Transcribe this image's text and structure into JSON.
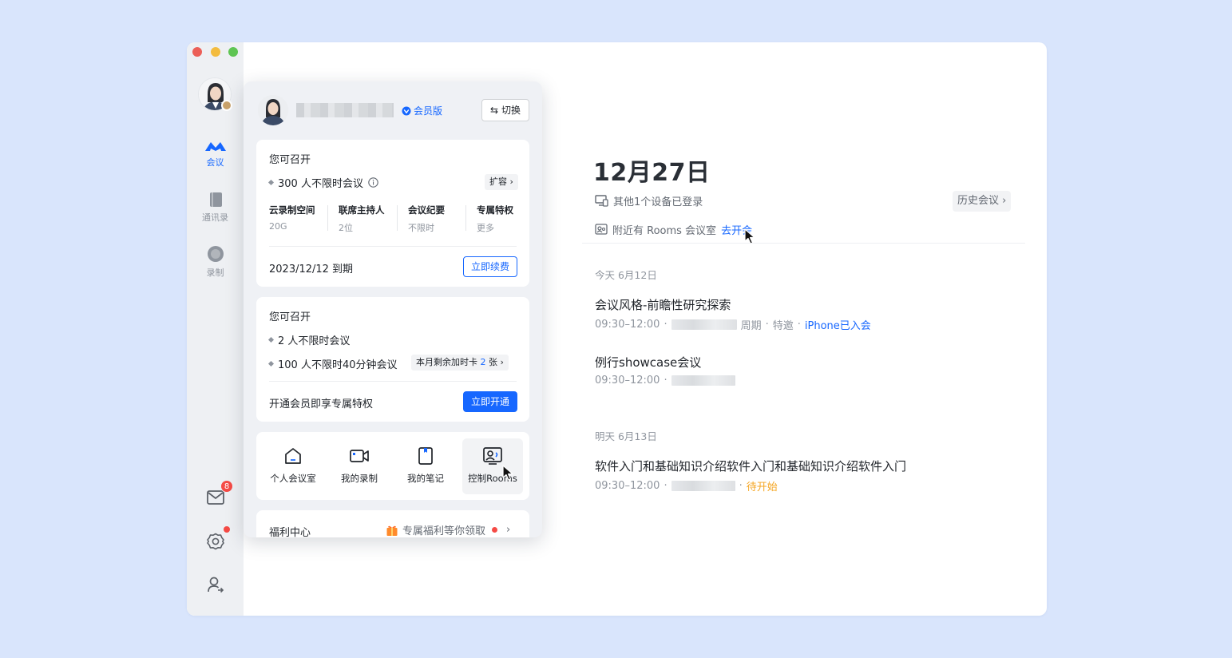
{
  "sidebar": {
    "nav": [
      {
        "label": "会议",
        "icon": "meeting-icon",
        "active": true
      },
      {
        "label": "通讯录",
        "icon": "address-book-icon",
        "active": false
      },
      {
        "label": "录制",
        "icon": "record-icon",
        "active": false
      }
    ],
    "mail_badge": "8"
  },
  "main": {
    "date": "12月27日",
    "device_notice": "其他1个设备已登录",
    "history_button": "历史会议",
    "rooms_notice": "附近有 Rooms 会议室",
    "rooms_link": "去开会",
    "today_label": "今天 6月12日",
    "tomorrow_label": "明天 6月13日",
    "meetings_today": [
      {
        "title": "会议风格-前瞻性研究探索",
        "time": "09:30–12:00",
        "tags": [
          "周期",
          "特邀"
        ],
        "status": "iPhone已入会"
      },
      {
        "title": "例行showcase会议",
        "time": "09:30–12:00"
      }
    ],
    "meetings_tomorrow": [
      {
        "title": "软件入门和基础知识介绍软件入门和基础知识介绍软件入门",
        "time": "09:30–12:00",
        "status": "待开始"
      }
    ]
  },
  "panel": {
    "vip_label": "会员版",
    "switch_button": "切换",
    "card1": {
      "head": "您可召开",
      "capacity": "300 人不限时会议",
      "expand_chip": "扩容",
      "features": [
        {
          "name": "云录制空间",
          "value": "20G"
        },
        {
          "name": "联席主持人",
          "value": "2位"
        },
        {
          "name": "会议纪要",
          "value": "不限时"
        },
        {
          "name": "专属特权",
          "value": "更多"
        }
      ],
      "expiry": "2023/12/12 到期",
      "renew_button": "立即续费"
    },
    "card2": {
      "head": "您可召开",
      "item1": "2 人不限时会议",
      "item2": "100 人不限时40分钟会议",
      "chip_text": "本月剩余加时卡",
      "chip_count": "2",
      "chip_unit": "张",
      "promo": "开通会员即享专属特权",
      "open_button": "立即开通"
    },
    "tools": [
      {
        "label": "个人会议室",
        "icon": "home-icon"
      },
      {
        "label": "我的录制",
        "icon": "video-camera-icon"
      },
      {
        "label": "我的笔记",
        "icon": "note-icon"
      },
      {
        "label": "控制Rooms",
        "icon": "rooms-control-icon"
      }
    ],
    "welfare": {
      "title": "福利中心",
      "promo": "专属福利等你领取"
    }
  }
}
